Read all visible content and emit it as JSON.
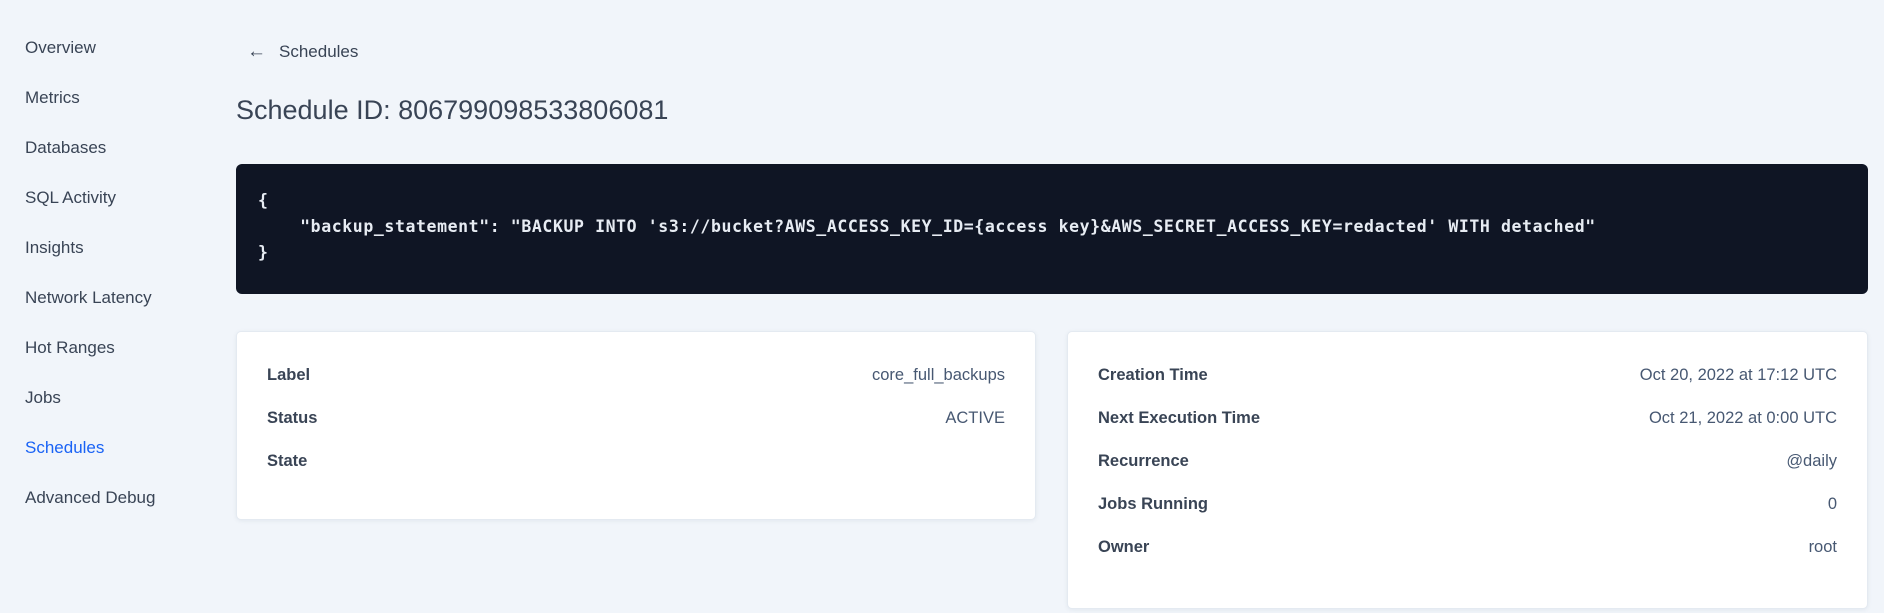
{
  "sidebar": {
    "items": [
      {
        "label": "Overview",
        "active": false
      },
      {
        "label": "Metrics",
        "active": false
      },
      {
        "label": "Databases",
        "active": false
      },
      {
        "label": "SQL Activity",
        "active": false
      },
      {
        "label": "Insights",
        "active": false
      },
      {
        "label": "Network Latency",
        "active": false
      },
      {
        "label": "Hot Ranges",
        "active": false
      },
      {
        "label": "Jobs",
        "active": false
      },
      {
        "label": "Schedules",
        "active": true
      },
      {
        "label": "Advanced Debug",
        "active": false
      }
    ]
  },
  "header": {
    "back_arrow_glyph": "←",
    "back_label": "Schedules",
    "title": "Schedule ID: 806799098533806081"
  },
  "code_block": {
    "code": "{\n    \"backup_statement\": \"BACKUP INTO 's3://bucket?AWS_ACCESS_KEY_ID={access key}&AWS_SECRET_ACCESS_KEY=redacted' WITH detached\"\n}"
  },
  "summary_card": {
    "rows": [
      {
        "label": "Label",
        "value": "core_full_backups"
      },
      {
        "label": "Status",
        "value": "ACTIVE"
      },
      {
        "label": "State",
        "value": ""
      }
    ]
  },
  "execution_card": {
    "rows": [
      {
        "label": "Creation Time",
        "value": "Oct 20, 2022 at 17:12 UTC"
      },
      {
        "label": "Next Execution Time",
        "value": "Oct 21, 2022 at 0:00 UTC"
      },
      {
        "label": "Recurrence",
        "value": "@daily"
      },
      {
        "label": "Jobs Running",
        "value": "0"
      },
      {
        "label": "Owner",
        "value": "root"
      }
    ]
  },
  "colors": {
    "page_background": "#f1f5fa",
    "accent_blue": "#1a63f5",
    "code_background": "#0f1524",
    "code_text": "#e7ecf3",
    "text_primary": "#394455",
    "text_secondary": "#475872"
  }
}
